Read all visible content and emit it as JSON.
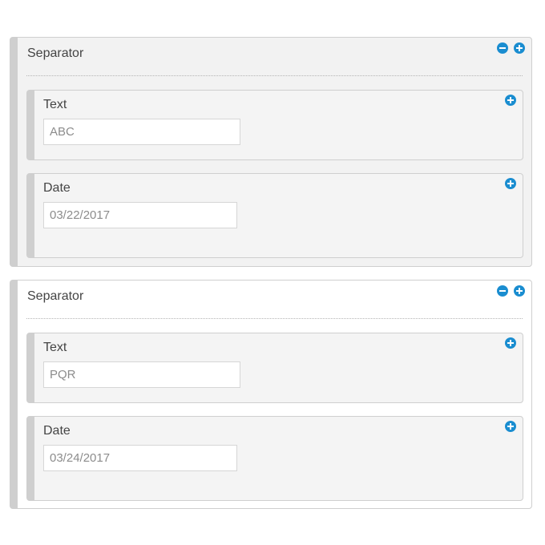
{
  "sections": [
    {
      "title": "Separator",
      "fields": [
        {
          "label": "Text",
          "value": "ABC"
        },
        {
          "label": "Date",
          "value": "03/22/2017"
        }
      ]
    },
    {
      "title": "Separator",
      "fields": [
        {
          "label": "Text",
          "value": "PQR"
        },
        {
          "label": "Date",
          "value": "03/24/2017"
        }
      ]
    }
  ],
  "icons": {
    "remove": "minus-circle-icon",
    "add": "plus-circle-icon"
  },
  "colors": {
    "accent": "#1a8dd0",
    "panel_bg": "#f2f2f2",
    "border": "#cfcfcf"
  }
}
